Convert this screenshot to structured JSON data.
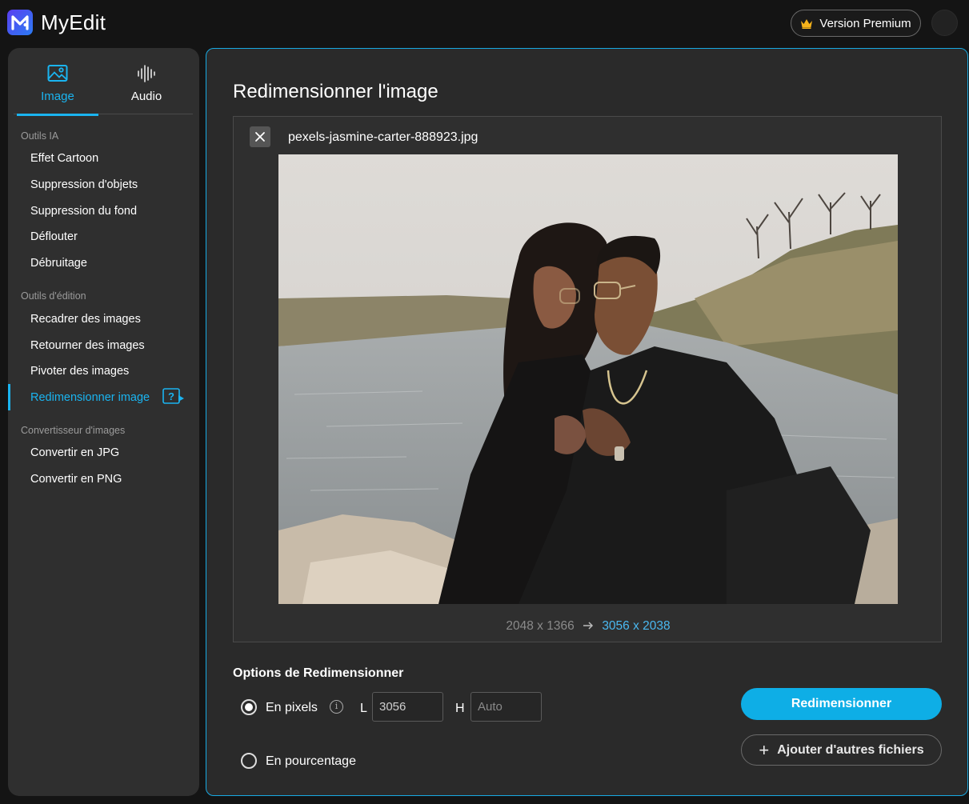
{
  "app": {
    "name": "MyEdit"
  },
  "header": {
    "premium_label": "Version Premium"
  },
  "sidebar": {
    "tabs": [
      {
        "label": "Image",
        "icon": "image-icon",
        "active": true
      },
      {
        "label": "Audio",
        "icon": "audio-wave-icon",
        "active": false
      }
    ],
    "sections": [
      {
        "title": "Outils IA",
        "items": [
          "Effet Cartoon",
          "Suppression d'objets",
          "Suppression du fond",
          "Déflouter",
          "Débruitage"
        ]
      },
      {
        "title": "Outils d'édition",
        "items": [
          "Recadrer des images",
          "Retourner des images",
          "Pivoter des images",
          "Redimensionner image"
        ]
      },
      {
        "title": "Convertisseur d'images",
        "items": [
          "Convertir en JPG",
          "Convertir en PNG"
        ]
      }
    ],
    "active_item": "Redimensionner image"
  },
  "main": {
    "title": "Redimensionner l'image",
    "file_name": "pexels-jasmine-carter-888923.jpg",
    "original_dims": "2048 x 1366",
    "new_dims": "3056 x 2038",
    "options_title": "Options de Redimensionner",
    "option_pixels": "En pixels",
    "option_percent": "En pourcentage",
    "selected_option": "En pixels",
    "width_label": "L",
    "width_value": "3056",
    "height_label": "H",
    "height_placeholder": "Auto",
    "resize_button": "Redimensionner",
    "add_files_button": "Ajouter d'autres fichiers"
  },
  "colors": {
    "accent": "#0eaee6",
    "panel": "#2a2a2a",
    "sidebar": "#2f2f2f"
  }
}
